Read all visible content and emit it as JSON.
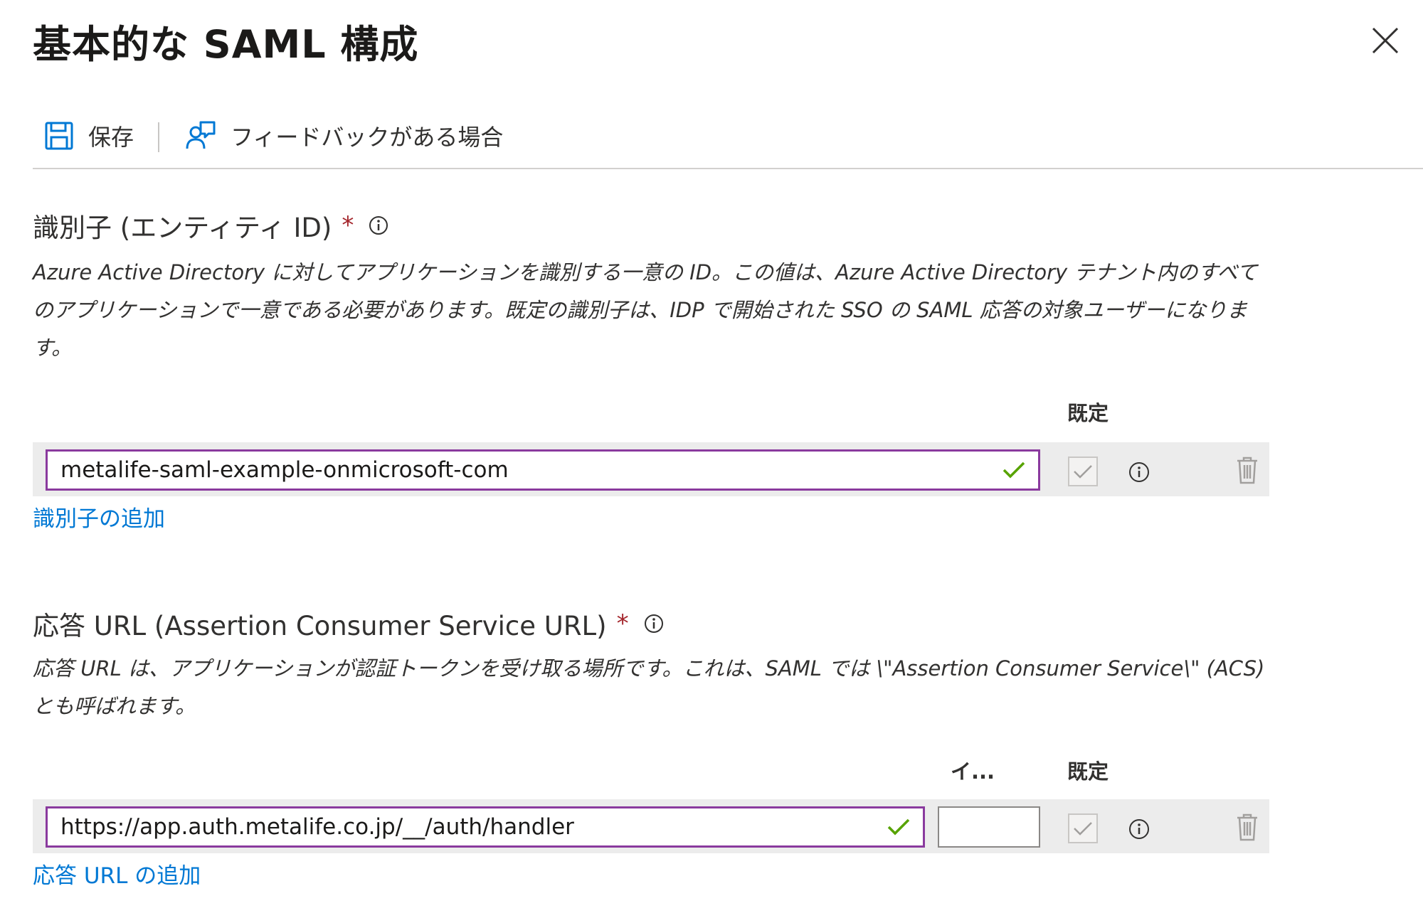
{
  "panel": {
    "title": "基本的な SAML 構成",
    "close_icon": "close-icon"
  },
  "toolbar": {
    "save_label": "保存",
    "save_icon": "save-icon",
    "feedback_label": "フィードバックがある場合",
    "feedback_icon": "feedback-icon"
  },
  "identifier": {
    "title": "識別子 (エンティティ ID)",
    "required_mark": "*",
    "description": "Azure Active Directory に対してアプリケーションを識別する一意の ID。この値は、Azure Active Directory テナント内のすべてのアプリケーションで一意である必要があります。既定の識別子は、IDP で開始された SSO の SAML 応答の対象ユーザーになります。",
    "column_default": "既定",
    "rows": [
      {
        "value": "metalife-saml-example-onmicrosoft-com",
        "valid": true,
        "is_default": false
      }
    ],
    "add_link": "識別子の追加"
  },
  "reply_url": {
    "title": "応答 URL (Assertion Consumer Service URL)",
    "required_mark": "*",
    "description": "応答 URL は、アプリケーションが認証トークンを受け取る場所です。これは、SAML では \\\"Assertion Consumer Service\\\" (ACS) とも呼ばれます。",
    "column_index": "イ...",
    "column_default": "既定",
    "rows": [
      {
        "value": "https://app.auth.metalife.co.jp/__/auth/handler",
        "index": "",
        "valid": true,
        "is_default": false
      }
    ],
    "add_link": "応答 URL の追加"
  },
  "colors": {
    "accent": "#0078d4",
    "input_border": "#8a3a9e",
    "valid_check": "#57a300",
    "required": "#a4262c"
  }
}
